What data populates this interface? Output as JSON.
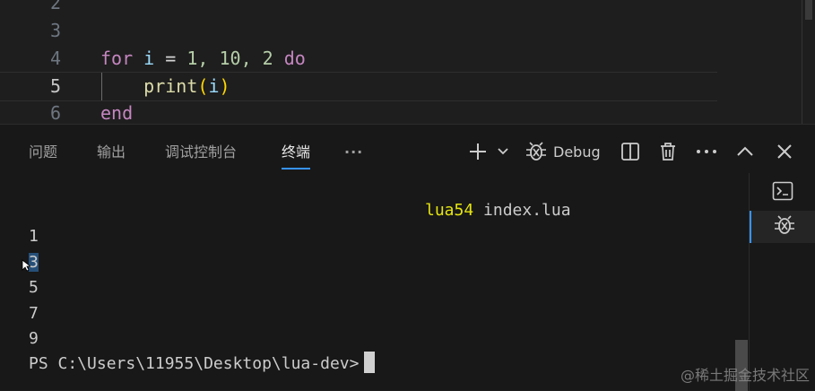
{
  "editor": {
    "lines": [
      {
        "num": "2",
        "code": ""
      },
      {
        "num": "3",
        "code": ""
      },
      {
        "num": "4",
        "code": "for i = 1, 10, 2 do"
      },
      {
        "num": "5",
        "code": "    print(i)"
      },
      {
        "num": "6",
        "code": "end"
      }
    ],
    "tokens": {
      "for": "for",
      "i": "i",
      "eq": "=",
      "n1": "1,",
      "n10": "10,",
      "n2": "2",
      "do": "do",
      "print": "print",
      "lp": "(",
      "arg": "i",
      "rp": ")",
      "end": "end"
    }
  },
  "panel": {
    "tabs": [
      {
        "label": "问题",
        "active": false
      },
      {
        "label": "输出",
        "active": false
      },
      {
        "label": "调试控制台",
        "active": false
      },
      {
        "label": "终端",
        "active": true
      }
    ],
    "more_tabs_label": "···",
    "toolbar": {
      "add_icon": "plus-icon",
      "profile_dropdown_icon": "chevron-down-icon",
      "debug_label": "Debug",
      "split_icon": "split-icon",
      "trash_icon": "trash-icon",
      "more_icon": "ellipsis-icon",
      "maximize_icon": "chevron-up-icon",
      "close_icon": "close-icon"
    }
  },
  "terminal": {
    "command_name": "lua54",
    "command_arg": " index.lua",
    "output": [
      "1",
      "3",
      "5",
      "7",
      "9"
    ],
    "prompt": "PS C:\\Users\\11955\\Desktop\\lua-dev>"
  },
  "side": {
    "items": [
      {
        "icon": "terminal-icon",
        "active": false
      },
      {
        "icon": "debug-icon",
        "active": true
      }
    ]
  },
  "watermark": "@稀土掘金技术社区",
  "colors": {
    "accent": "#3794ff",
    "keyword": "#c586c0",
    "function": "#dcdcaa",
    "number": "#b5cea8",
    "bracket": "#ffd700",
    "command": "#e5e510"
  }
}
